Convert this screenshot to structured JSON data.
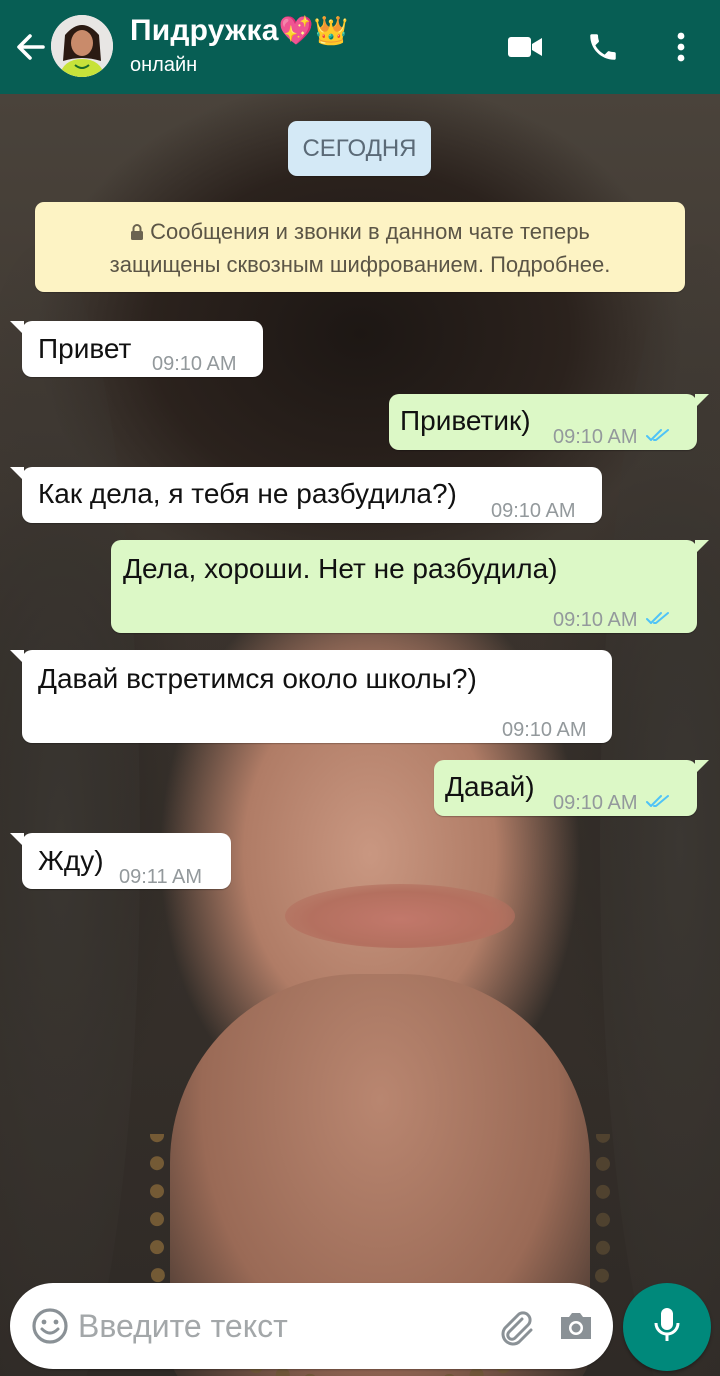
{
  "header": {
    "contact_name": "Пидружка",
    "contact_emoji": "💖👑",
    "status": "онлайн",
    "icons": [
      "back-arrow-icon",
      "video-call-icon",
      "phone-icon",
      "more-vertical-icon"
    ]
  },
  "chat": {
    "date_chip": "СЕГОДНЯ",
    "encryption_notice": {
      "line1": "Сообщения и звонки в данном чате теперь",
      "line2": "защищены сквозным шифрованием. Подробнее."
    },
    "messages": [
      {
        "direction": "in",
        "text": "Привет",
        "time": "09:10 AM"
      },
      {
        "direction": "out",
        "text": "Приветик)",
        "time": "09:10 AM",
        "status": "read"
      },
      {
        "direction": "in",
        "text": "Как дела, я тебя не разбудила?)",
        "time": "09:10 AM"
      },
      {
        "direction": "out",
        "text": "Дела, хороши. Нет не разбудила)",
        "time": "09:10 AM",
        "status": "read"
      },
      {
        "direction": "in",
        "text": "Давай встретимся около школы?)",
        "time": "09:10 AM"
      },
      {
        "direction": "out",
        "text": "Давай)",
        "time": "09:10 AM",
        "status": "read"
      },
      {
        "direction": "in",
        "text": "Жду)",
        "time": "09:11 AM"
      }
    ]
  },
  "composer": {
    "placeholder": "Введите текст",
    "value": ""
  },
  "colors": {
    "header_bg": "#075e54",
    "incoming_bubble": "#ffffff",
    "outgoing_bubble": "#dcf8c6",
    "read_ticks": "#4fc3f7",
    "mic_button": "#00897b",
    "date_chip_bg": "#d4e9f6",
    "notice_bg": "#fdf3c4"
  }
}
